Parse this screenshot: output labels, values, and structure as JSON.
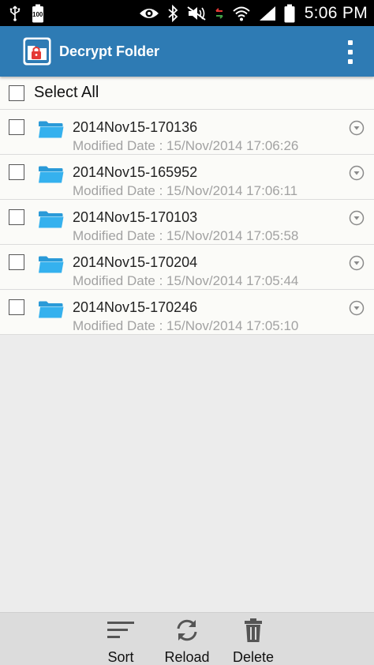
{
  "status_bar": {
    "battery_level": "100",
    "time": "5:06 PM",
    "icons": [
      "usb-icon",
      "battery-saver-icon",
      "eye-icon",
      "bluetooth-icon",
      "mute-icon",
      "data-transfer-icon",
      "wifi-icon",
      "signal-icon",
      "battery-icon"
    ]
  },
  "app_bar": {
    "title": "Decrypt Folder",
    "color": "#2e7bb4"
  },
  "list": {
    "select_all_label": "Select All",
    "items": [
      {
        "name": "2014Nov15-170136",
        "date": "Modified Date : 15/Nov/2014 17:06:26"
      },
      {
        "name": "2014Nov15-165952",
        "date": "Modified Date : 15/Nov/2014 17:06:11"
      },
      {
        "name": "2014Nov15-170103",
        "date": "Modified Date : 15/Nov/2014 17:05:58"
      },
      {
        "name": "2014Nov15-170204",
        "date": "Modified Date : 15/Nov/2014 17:05:44"
      },
      {
        "name": "2014Nov15-170246",
        "date": "Modified Date : 15/Nov/2014 17:05:10"
      }
    ]
  },
  "bottom_bar": {
    "sort_label": "Sort",
    "reload_label": "Reload",
    "delete_label": "Delete"
  }
}
